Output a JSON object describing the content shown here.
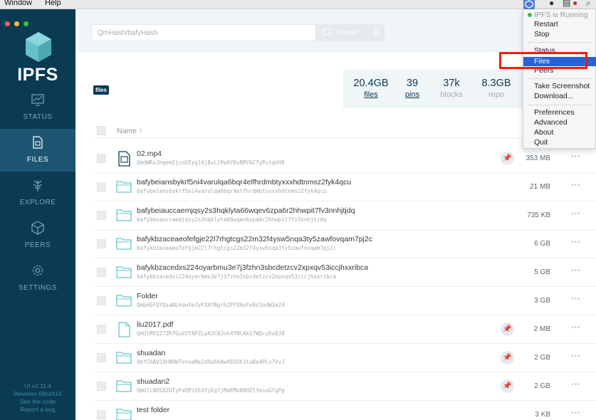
{
  "menubar": {
    "items": [
      "Window",
      "Help"
    ]
  },
  "sidebar": {
    "brand": "IPFS",
    "nav": [
      {
        "id": "status",
        "label": "STATUS",
        "icon": "status-monitor-icon",
        "active": false
      },
      {
        "id": "files",
        "label": "FILES",
        "icon": "files-icon",
        "active": true
      },
      {
        "id": "explore",
        "label": "EXPLORE",
        "icon": "explore-tree-icon",
        "active": false
      },
      {
        "id": "peers",
        "label": "PEERS",
        "icon": "peers-cube-icon",
        "active": false
      },
      {
        "id": "settings",
        "label": "SETTINGS",
        "icon": "settings-gear-icon",
        "active": false
      }
    ],
    "version": "UI v2.11.4",
    "revision": "Revision 69cd414",
    "see_code": "See the code",
    "report_bug": "Report a bug"
  },
  "topbar": {
    "search_placeholder": "QmHash/bafyHash",
    "browse_label": "Browse"
  },
  "breadcrumb": {
    "root": "files"
  },
  "stats": [
    {
      "value": "20.4GB",
      "label": "files",
      "link": true
    },
    {
      "value": "39",
      "label": "pins",
      "link": true
    },
    {
      "value": "37k",
      "label": "blocks",
      "link": false
    },
    {
      "value": "8.3GB",
      "label": "repo",
      "link": false
    }
  ],
  "table": {
    "header_name": "Name ↑",
    "rows": [
      {
        "name": "02.mp4",
        "hash": "QmdWRxJhqekEjcnEEyg14jBvLtPwXYRvRMYGC7yPutqhH8",
        "size": "353 MB",
        "type": "video",
        "pinned": true
      },
      {
        "name": "bafybeiansbykrf5ni4varulqa6bqr4elfhrdmbtyxxxhdtnmsz2fyk4qcu",
        "hash": "bafybeiansbykrf5ni4varulqa6bqr4elfhrdmbtyxxxhdtnmsz2fyk4qcu",
        "size": "21 MB",
        "type": "folder",
        "pinned": false
      },
      {
        "name": "bafybeiauccaemjqsy2s3hqklyta66wqev6zpa6r2hhwpit7fv3nnhjtjdq",
        "hash": "bafybeiauccaemjqsy2s3hqklyta66wqev6zpa6r2hhwpit7fv3nnhjtjdq",
        "size": "735 KB",
        "type": "folder",
        "pinned": false
      },
      {
        "name": "bafykbzaceaeofefgje22l7rhgtcgs22m32f4ysw5nqa3ty5zawfovqam7pj2c",
        "hash": "bafykbzaceaeofefgje22l7rhgtcgs22m32f4ysw5nqa3ty5zawfovqam7pj2c",
        "size": "6 GB",
        "type": "folder",
        "pinned": false
      },
      {
        "name": "bafykbzacedxs224oyarbmu3e7j3fzhn3sbcdetzcv2xpxqv53iccjhxxribca",
        "hash": "bafykbzacedxs224oyarbmu3e7j3fzhn3sbcdetzcv2xpxqv53iccjhxxribca",
        "size": "5 GB",
        "type": "folder",
        "pinned": false
      },
      {
        "name": "Folder",
        "hash": "QmbmSFQYQsaNLkowYeJyFXAfBgrhJPYXHvFw9s3odW3a24",
        "size": "3 GB",
        "type": "folder",
        "pinned": false
      },
      {
        "name": "liu2017.pdf",
        "hash": "QmUiMV2Z7ZKfGuVZYAPZLpA3CBJoh4YNCAk17WQcyDx8J8",
        "size": "2 MB",
        "type": "file",
        "pinned": true
      },
      {
        "name": "shuadan",
        "hash": "QmfCHAU19nN9WTvnvaMeZdXw5kAwX65Dh3tuBe4PLv7VvJ",
        "size": "2 GB",
        "type": "folder",
        "pinned": true
      },
      {
        "name": "shuadan2",
        "hash": "QmU7cAEGXZUTyFeQPihEdYyEg7jMaEMo88HZtYesoGYgPg",
        "size": "2 GB",
        "type": "folder",
        "pinned": true
      },
      {
        "name": "test folder",
        "hash": "",
        "size": "3 KB",
        "type": "folder",
        "pinned": false
      }
    ]
  },
  "tray_menu": {
    "status_line": "IPFS is Running",
    "items": {
      "restart": "Restart",
      "stop": "Stop",
      "status": "Status",
      "files": "Files",
      "peers": "Peers",
      "screenshot": "Take Screenshot",
      "download": "Download...",
      "preferences": "Preferences",
      "advanced": "Advanced",
      "about": "About",
      "quit": "Quit"
    },
    "highlighted": "Files"
  },
  "colors": {
    "sidebar_bg": "#0b3a53",
    "sidebar_active": "#1c5673",
    "teal": "#69c4cd",
    "menu_highlight": "#2862d7",
    "annotation_red": "#ff1a0a"
  }
}
